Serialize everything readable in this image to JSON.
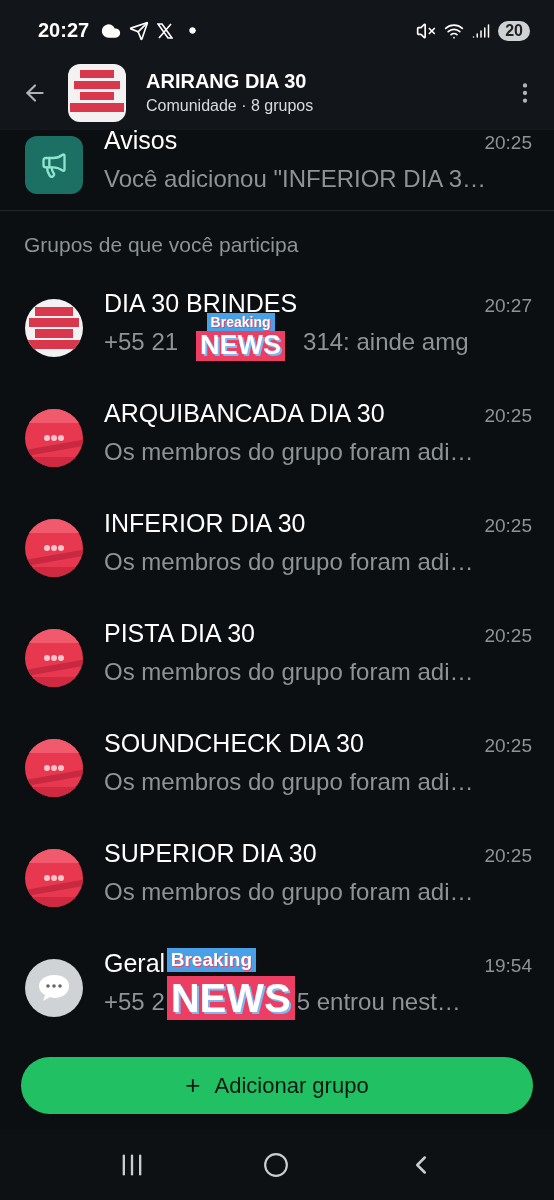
{
  "status_bar": {
    "time": "20:27",
    "battery": "20"
  },
  "header": {
    "title": "ARIRANG DIA 30",
    "subtitle": "Comunidade · 8 grupos"
  },
  "announcements": {
    "name": "Avisos",
    "time": "20:25",
    "preview": "Você adicionou \"INFERIOR DIA 3…"
  },
  "section_title": "Grupos de que você participa",
  "groups": [
    {
      "name": "DIA 30 BRINDES",
      "time": "20:27",
      "kind": "logo",
      "preview": "+55 21",
      "preview_after": "314: ainde amg",
      "sticker": {
        "kind": "small",
        "top": "Breaking",
        "bottom": "NEWS"
      }
    },
    {
      "name": "ARQUIBANCADA DIA 30",
      "time": "20:25",
      "kind": "red",
      "preview": "Os membros do grupo foram adi…"
    },
    {
      "name": "INFERIOR DIA 30",
      "time": "20:25",
      "kind": "red",
      "preview": "Os membros do grupo foram adi…"
    },
    {
      "name": "PISTA DIA 30",
      "time": "20:25",
      "kind": "red",
      "preview": "Os membros do grupo foram adi…"
    },
    {
      "name": "SOUNDCHECK DIA 30",
      "time": "20:25",
      "kind": "red",
      "preview": "Os membros do grupo foram adi…"
    },
    {
      "name": "SUPERIOR DIA 30",
      "time": "20:25",
      "kind": "red",
      "preview": "Os membros do grupo foram adi…"
    },
    {
      "name": "Geral",
      "time": "19:54",
      "kind": "bubble",
      "preview": "+55 2",
      "preview_after": "5 entrou nest…",
      "sticker": {
        "kind": "large",
        "top": "Breaking",
        "bottom": "NEWS"
      }
    }
  ],
  "add_button": {
    "icon": "+",
    "label": "Adicionar grupo"
  }
}
